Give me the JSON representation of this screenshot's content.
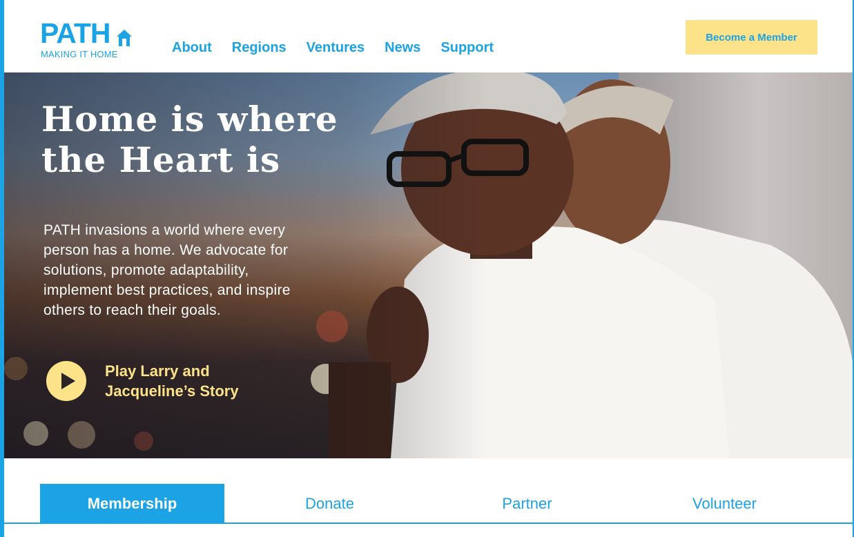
{
  "logo": {
    "word": "PATH",
    "tagline": "MAKING IT HOME"
  },
  "nav": [
    "About",
    "Regions",
    "Ventures",
    "News",
    "Support"
  ],
  "header": {
    "cta_label": "Become a Member"
  },
  "hero": {
    "title": "Home is where the Heart is",
    "body": "PATH invasions a world where every person has a home. We advocate for solutions, promote adaptability, implement best practices, and inspire others to reach their goals.",
    "play_label": "Play Larry and Jacqueline’s Story"
  },
  "tabs": [
    {
      "label": "Membership",
      "active": true
    },
    {
      "label": "Donate",
      "active": false
    },
    {
      "label": "Partner",
      "active": false
    },
    {
      "label": "Volunteer",
      "active": false
    }
  ],
  "colors": {
    "brand_blue": "#1ba3e6",
    "accent_yellow": "#fce38a"
  }
}
